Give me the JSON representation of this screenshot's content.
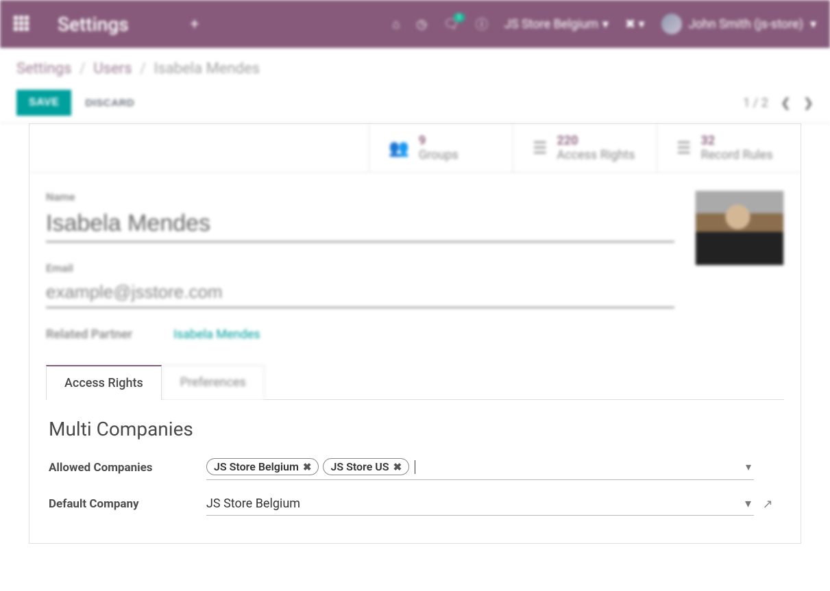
{
  "header": {
    "app_title": "Settings",
    "company": "JS Store Belgium",
    "user": "John Smith (js-store)",
    "msg_count": "1"
  },
  "breadcrumb": {
    "l1": "Settings",
    "l2": "Users",
    "l3": "Isabela Mendes"
  },
  "buttons": {
    "save": "SAVE",
    "discard": "DISCARD"
  },
  "pager": {
    "text": "1 / 2"
  },
  "stats": {
    "groups_n": "9",
    "groups_l": "Groups",
    "rights_n": "220",
    "rights_l": "Access Rights",
    "rules_n": "32",
    "rules_l": "Record Rules"
  },
  "form": {
    "name_label": "Name",
    "name_value": "Isabela Mendes",
    "email_label": "Email",
    "email_value": "example@jsstore.com",
    "related_label": "Related Partner",
    "related_value": "Isabela Mendes"
  },
  "tabs": {
    "t1": "Access Rights",
    "t2": "Preferences"
  },
  "multi": {
    "title": "Multi Companies",
    "allowed_label": "Allowed Companies",
    "tag1": "JS Store Belgium",
    "tag2": "JS Store US",
    "default_label": "Default Company",
    "default_value": "JS Store Belgium"
  }
}
